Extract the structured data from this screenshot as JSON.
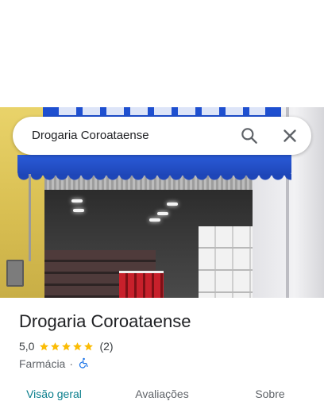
{
  "search": {
    "query": "Drogaria Coroataense",
    "search_icon": "search-icon",
    "close_icon": "close-icon"
  },
  "photo": {
    "description_icon": "storefront-photo"
  },
  "place": {
    "name": "Drogaria Coroataense",
    "rating": "5,0",
    "stars": 5,
    "review_count": "(2)",
    "category": "Farmácia",
    "separator": "·",
    "accessibility_icon": "wheelchair-accessible-icon"
  },
  "tabs": [
    {
      "label": "Visão geral",
      "active": true
    },
    {
      "label": "Avaliações",
      "active": false
    },
    {
      "label": "Sobre",
      "active": false
    }
  ],
  "colors": {
    "accent": "#0a7e8c",
    "star": "#fbbc04",
    "accessibility": "#1a73e8",
    "text_primary": "#202124",
    "text_secondary": "#5f6368"
  }
}
